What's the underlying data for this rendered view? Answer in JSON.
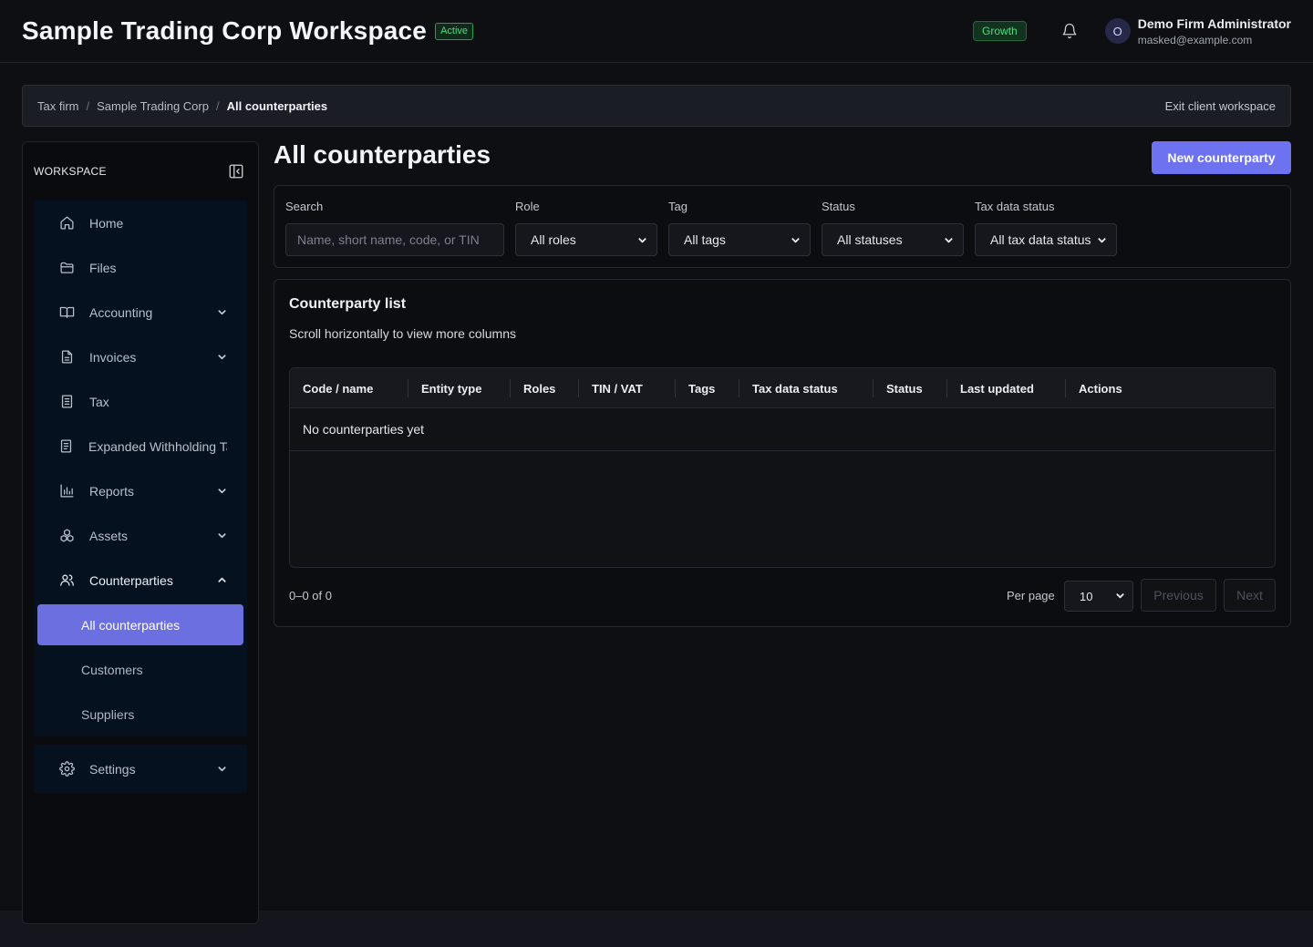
{
  "header": {
    "workspace_title": "Sample Trading Corp Workspace",
    "status_badge": "Active",
    "plan_badge": "Growth",
    "notifications_icon": "bell-icon",
    "user": {
      "avatar_initial": "O",
      "name": "Demo Firm Administrator",
      "email": "masked@example.com"
    }
  },
  "breadcrumb": {
    "items": [
      "Tax firm",
      "Sample Trading Corp"
    ],
    "separator": "/",
    "current": "All counterparties",
    "exit_label": "Exit client workspace"
  },
  "sidebar": {
    "section_label": "WORKSPACE",
    "collapse_icon": "sidebar-collapse-icon",
    "items": [
      {
        "label": "Home",
        "icon": "home-icon",
        "has_chevron": false
      },
      {
        "label": "Files",
        "icon": "folder-icon",
        "has_chevron": false
      },
      {
        "label": "Accounting",
        "icon": "book-icon",
        "has_chevron": true
      },
      {
        "label": "Invoices",
        "icon": "file-text-icon",
        "has_chevron": true
      },
      {
        "label": "Tax",
        "icon": "receipt-icon",
        "has_chevron": false
      },
      {
        "label": "Expanded Withholding Tax",
        "icon": "document-icon",
        "has_chevron": false
      },
      {
        "label": "Reports",
        "icon": "bar-chart-icon",
        "has_chevron": true
      },
      {
        "label": "Assets",
        "icon": "boxes-icon",
        "has_chevron": true
      },
      {
        "label": "Counterparties",
        "icon": "users-icon",
        "has_chevron": true,
        "expanded": true
      }
    ],
    "sub_items": [
      {
        "label": "All counterparties",
        "active": true
      },
      {
        "label": "Customers",
        "active": false
      },
      {
        "label": "Suppliers",
        "active": false
      }
    ],
    "settings": {
      "label": "Settings",
      "icon": "gear-icon"
    }
  },
  "main": {
    "title": "All counterparties",
    "new_button": "New counterparty",
    "filters": {
      "search_label": "Search",
      "search_placeholder": "Name, short name, code, or TIN",
      "role_label": "Role",
      "role_value": "All roles",
      "tag_label": "Tag",
      "tag_value": "All tags",
      "status_label": "Status",
      "status_value": "All statuses",
      "tax_label": "Tax data status",
      "tax_value": "All tax data status"
    },
    "list": {
      "title": "Counterparty list",
      "subtitle": "Scroll horizontally to view more columns",
      "columns": [
        "Code / name",
        "Entity type",
        "Roles",
        "TIN / VAT",
        "Tags",
        "Tax data status",
        "Status",
        "Last updated",
        "Actions"
      ],
      "empty_message": "No counterparties yet"
    },
    "pagination": {
      "range": "0–0 of 0",
      "per_page_label": "Per page",
      "per_page_value": "10",
      "previous": "Previous",
      "next": "Next"
    }
  },
  "colors": {
    "accent": "#6d72f0",
    "active_badge": "#4ade80",
    "nav_bg": "#061120",
    "background": "#0e0f12"
  }
}
